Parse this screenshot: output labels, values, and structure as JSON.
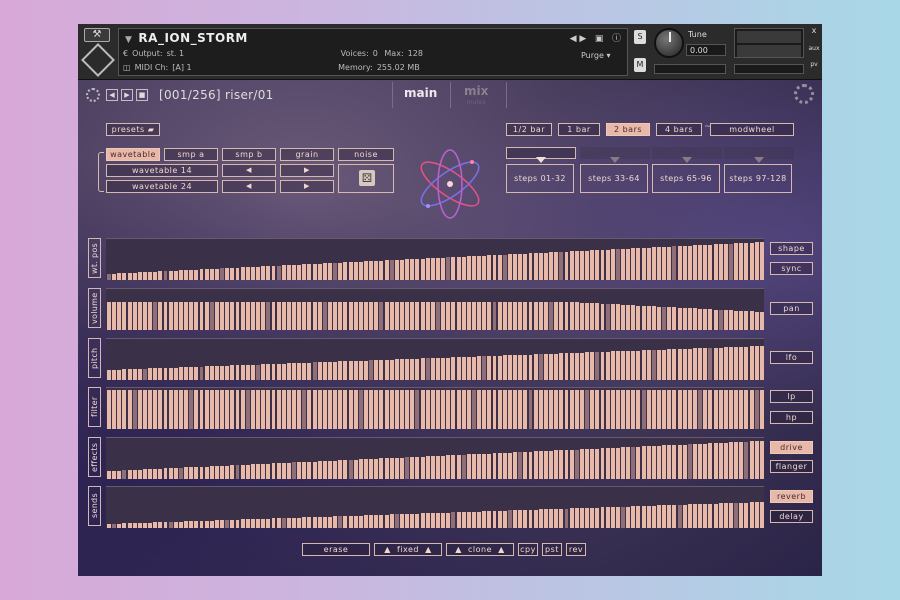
{
  "header": {
    "instrument_name": "RA_ION_STORM",
    "output_label": "Output:",
    "output_value": "st. 1",
    "voices_label": "Voices:",
    "voices_value": "0",
    "max_label": "Max:",
    "max_value": "128",
    "midi_label": "MIDI Ch:",
    "midi_value": "[A] 1",
    "memory_label": "Memory:",
    "memory_value": "255.02 MB",
    "purge_label": "Purge",
    "tune_label": "Tune",
    "tune_value": "0.00",
    "solo_label": "S",
    "mute_label": "M",
    "close_label": "x",
    "aux_label": "aux",
    "pv_label": "pv"
  },
  "nav": {
    "preset_counter": "[001/256]",
    "preset_name": "riser/01",
    "tab_main": "main",
    "tab_mix": "mix",
    "tab_mix_sub": "mutes"
  },
  "controls": {
    "presets_label": "presets",
    "source_tabs": [
      "wavetable",
      "smp a",
      "smp b",
      "grain",
      "noise"
    ],
    "wavetable_a": "wavetable 14",
    "wavetable_b": "wavetable 24",
    "arrow_left": "◀",
    "arrow_right": "▶"
  },
  "length": {
    "options": [
      "1/2 bar",
      "1 bar",
      "2 bars",
      "4 bars"
    ],
    "selected": "2 bars",
    "tilde": "~",
    "modwheel": "modwheel"
  },
  "steps": [
    "steps 01-32",
    "steps 33-64",
    "steps 65-96",
    "steps 97-128"
  ],
  "lanes": [
    {
      "label": "wt. pos",
      "side": [
        "shape",
        "sync"
      ]
    },
    {
      "label": "volume",
      "side": [
        "pan"
      ]
    },
    {
      "label": "pitch",
      "side": [
        "lfo"
      ]
    },
    {
      "label": "filter",
      "side": [
        "lp",
        "hp"
      ]
    },
    {
      "label": "effects",
      "side": [
        "drive",
        "flanger"
      ]
    },
    {
      "label": "sends",
      "side": [
        "reverb",
        "delay"
      ]
    }
  ],
  "side_active": [
    "drive",
    "reverb"
  ],
  "bottom": {
    "erase": "erase",
    "fixed": "fixed",
    "clone": "clone",
    "cpy": "cpy",
    "pst": "pst",
    "rev": "rev",
    "up_arrow": "▲"
  },
  "colors": {
    "accent": "#e8b8a8",
    "panel": "#3a3048",
    "border": "#d6b8b0"
  }
}
